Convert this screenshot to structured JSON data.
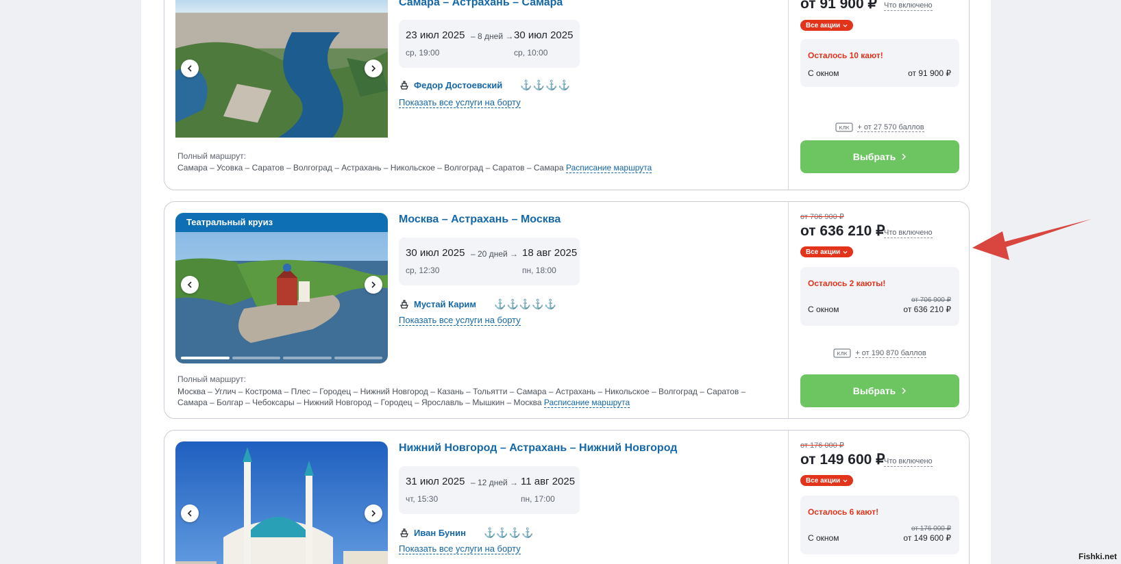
{
  "cruises": [
    {
      "photo_badge": "",
      "title": "Самара – Астрахань – Самара",
      "depart_date": "23 июл 2025",
      "depart_time": "ср, 19:00",
      "duration": "– 8 дней →",
      "arrive_date": "30 июл 2025",
      "arrive_time": "ср, 10:00",
      "ship": "Федор Достоевский",
      "anchors": "⚓⚓⚓⚓",
      "services_link": "Показать все услуги на борту",
      "route_label": "Полный маршрут:",
      "route": "Самара – Усовка – Саратов – Волгоград – Астрахань – Никольское – Волгоград – Саратов – Самара",
      "schedule_link": "Расписание маршрута",
      "old_price": "",
      "price": "от 91 900 ₽",
      "included_link": "Что включено",
      "promo": "Все акции",
      "cabins_left": "Осталось 10 кают!",
      "cabin_type": "С окном",
      "cabin_old_price": "",
      "cabin_price": "от 91 900 ₽",
      "points": "+ от 27 570 баллов",
      "select_label": "Выбрать"
    },
    {
      "photo_badge": "Театральный круиз",
      "title": "Москва – Астрахань – Москва",
      "depart_date": "30 июл 2025",
      "depart_time": "ср, 12:30",
      "duration": "– 20 дней →",
      "arrive_date": "18 авг 2025",
      "arrive_time": "пн, 18:00",
      "ship": "Мустай Карим",
      "anchors": "⚓⚓⚓⚓⚓",
      "services_link": "Показать все услуги на борту",
      "route_label": "Полный маршрут:",
      "route": "Москва – Углич – Кострома – Плес – Городец – Нижний Новгород – Казань – Тольятти – Самара – Астрахань – Никольское – Волгоград – Саратов – Самара – Болгар – Чебоксары – Нижний Новгород – Городец – Ярославль – Мышкин – Москва",
      "schedule_link": "Расписание маршрута",
      "old_price": "от 706 900 ₽",
      "price": "от 636 210 ₽",
      "included_link": "Что включено",
      "promo": "Все акции",
      "cabins_left": "Осталось 2 каюты!",
      "cabin_type": "С окном",
      "cabin_old_price": "от 706 900 ₽",
      "cabin_price": "от 636 210 ₽",
      "points": "+ от 190 870 баллов",
      "select_label": "Выбрать"
    },
    {
      "photo_badge": "",
      "title": "Нижний Новгород – Астрахань – Нижний Новгород",
      "depart_date": "31 июл 2025",
      "depart_time": "чт, 15:30",
      "duration": "– 12 дней →",
      "arrive_date": "11 авг 2025",
      "arrive_time": "пн, 17:00",
      "ship": "Иван Бунин",
      "anchors": "⚓⚓⚓⚓",
      "services_link": "Показать все услуги на борту",
      "old_price": "от 176 000 ₽",
      "price": "от 149 600 ₽",
      "included_link": "Что включено",
      "promo": "Все акции",
      "cabins_left": "Осталось 6 кают!",
      "cabin_type": "С окном",
      "cabin_old_price": "от 176 000 ₽",
      "cabin_price": "от 149 600 ₽"
    }
  ],
  "watermark": "Fishki.net",
  "colors": {
    "link_blue": "#1467a8",
    "accent_red": "#e2331b",
    "select_green": "#6cc560",
    "annotation_red": "#d9453f"
  }
}
